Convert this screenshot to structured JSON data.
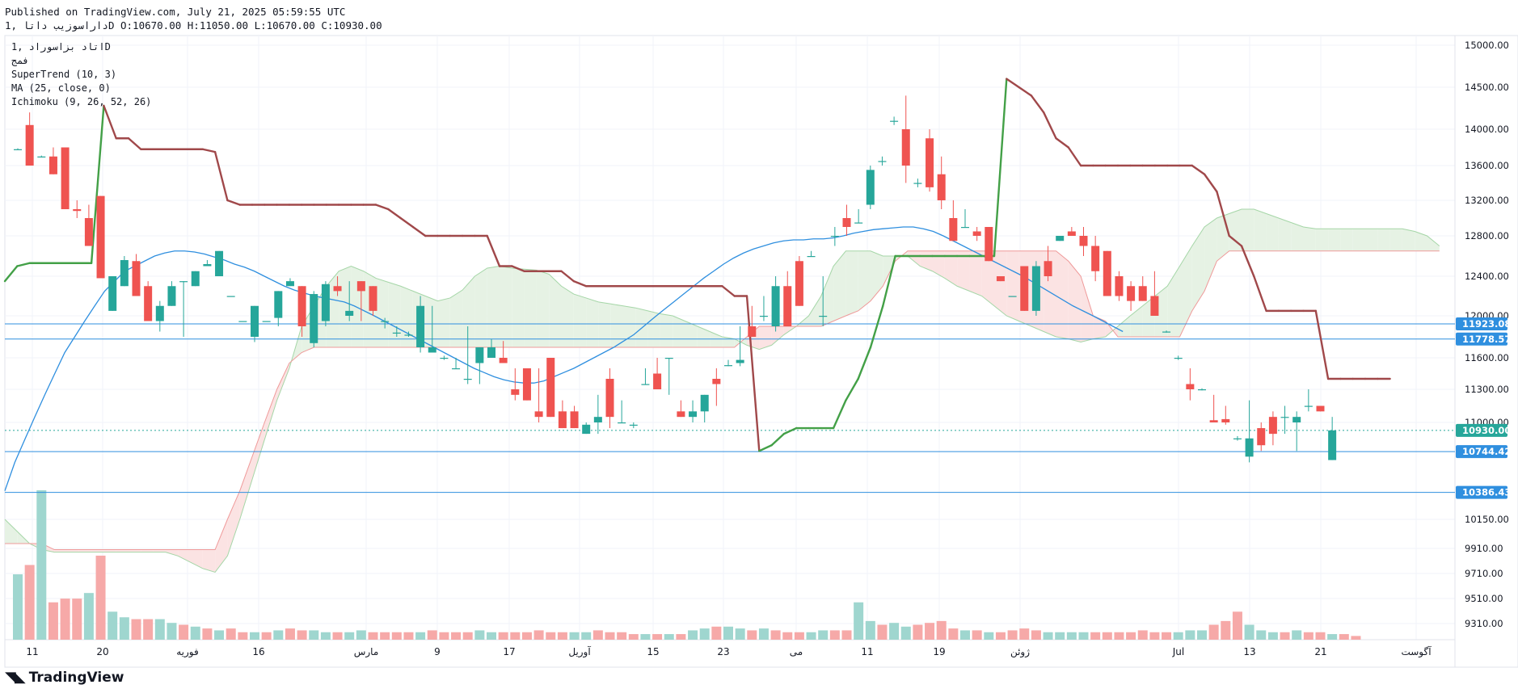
{
  "header": {
    "published": "Published on TradingView.com, July 21, 2025 05:59:55 UTC",
    "ohlc_line": "داراسوزیب داتا ,1D O:10670.00 H:11050.00 L:10670.00 C:10930.00"
  },
  "legend": {
    "symbol": "اتاد بزاسوراد ,1D",
    "exchange": "فمج",
    "indicators": [
      "SuperTrend (10, 3)",
      "MA (25, close, 0)",
      "Ichimoku (9, 26, 52, 26)"
    ]
  },
  "brand": {
    "name": "TradingView",
    "logo": "tradingview-logo-icon"
  },
  "colors": {
    "up": "#26a69a",
    "down": "#ef5350",
    "supertrend_up": "#43a047",
    "supertrend_down": "#a0484a",
    "ma": "#2f8fdf",
    "hline": "#2f8fdf",
    "cloud_bull": "#e6f2e4",
    "cloud_bear": "#fbe3e3"
  },
  "chart_data": {
    "type": "candlestick",
    "interval": "1D",
    "y_axis_ticks": [
      15000,
      14500,
      14000,
      13600,
      13200,
      12800,
      12400,
      12000,
      11600,
      11300,
      11000,
      10150,
      9910,
      9710,
      9510,
      9310
    ],
    "x_axis_ticks": [
      "11",
      "20",
      "فوریه",
      "16",
      "مارس",
      "9",
      "17",
      "آوریل",
      "15",
      "23",
      "می",
      "11",
      "19",
      "ژوئن",
      "Jul",
      "13",
      "21",
      "آگوست"
    ],
    "price_labels": [
      {
        "value": 11923.08,
        "label": "11923.08",
        "kind": "line"
      },
      {
        "value": 11778.57,
        "label": "11778.57",
        "kind": "line"
      },
      {
        "value": 10930.0,
        "label": "10930.00",
        "kind": "last"
      },
      {
        "value": 10744.42,
        "label": "10744.42",
        "kind": "line"
      },
      {
        "value": 10386.43,
        "label": "10386.43",
        "kind": "line"
      }
    ],
    "candles": [
      [
        13780,
        13790,
        13770,
        13780
      ],
      [
        14050,
        14200,
        13700,
        13600
      ],
      [
        13700,
        13710,
        13690,
        13700
      ],
      [
        13700,
        13800,
        13500,
        13500
      ],
      [
        13800,
        13800,
        13100,
        13100
      ],
      [
        13100,
        13200,
        13000,
        13080
      ],
      [
        13000,
        13150,
        12700,
        12700
      ],
      [
        13250,
        13250,
        12400,
        12380
      ],
      [
        12050,
        12400,
        12050,
        12400
      ],
      [
        12300,
        12600,
        12300,
        12560
      ],
      [
        12550,
        12620,
        12200,
        12200
      ],
      [
        12300,
        12350,
        11950,
        11950
      ],
      [
        11950,
        12150,
        11850,
        12100
      ],
      [
        12100,
        12350,
        12100,
        12300
      ],
      [
        12350,
        12350,
        11800,
        12350
      ],
      [
        12300,
        12450,
        12300,
        12450
      ],
      [
        12500,
        12560,
        12500,
        12520
      ],
      [
        12400,
        12650,
        12400,
        12650
      ],
      [
        12200,
        12200,
        12200,
        12200
      ],
      [
        11950,
        11950,
        11950,
        11950
      ],
      [
        11800,
        12100,
        11750,
        12100
      ],
      [
        11950,
        11950,
        11950,
        11950
      ],
      [
        11980,
        12250,
        11900,
        12250
      ],
      [
        12300,
        12380,
        12300,
        12350
      ],
      [
        12300,
        12300,
        11800,
        11900
      ],
      [
        11740,
        12250,
        11700,
        12220
      ],
      [
        11950,
        12350,
        11900,
        12320
      ],
      [
        12300,
        12400,
        12200,
        12250
      ],
      [
        12000,
        12350,
        11950,
        12050
      ],
      [
        12350,
        12350,
        11950,
        12250
      ],
      [
        12300,
        12300,
        12000,
        12050
      ],
      [
        11950,
        11980,
        11880,
        11950
      ],
      [
        11840,
        11900,
        11800,
        11840
      ],
      [
        11820,
        11850,
        11800,
        11820
      ],
      [
        11700,
        12200,
        11650,
        12100
      ],
      [
        11650,
        12100,
        11650,
        11700
      ],
      [
        11600,
        11620,
        11580,
        11600
      ],
      [
        11500,
        11600,
        11500,
        11500
      ],
      [
        11400,
        11900,
        11350,
        11400
      ],
      [
        11550,
        11700,
        11350,
        11700
      ],
      [
        11600,
        11780,
        11600,
        11700
      ],
      [
        11600,
        11760,
        11580,
        11550
      ],
      [
        11300,
        11500,
        11200,
        11250
      ],
      [
        11500,
        11500,
        11200,
        11200
      ],
      [
        11100,
        11500,
        11000,
        11050
      ],
      [
        11600,
        11600,
        11050,
        11050
      ],
      [
        11100,
        11200,
        10950,
        10950
      ],
      [
        11100,
        11150,
        10950,
        10950
      ],
      [
        10900,
        11000,
        10900,
        10980
      ],
      [
        11000,
        11250,
        10900,
        11050
      ],
      [
        11400,
        11500,
        10950,
        11050
      ],
      [
        11000,
        11200,
        11000,
        11000
      ],
      [
        10980,
        11000,
        10950,
        10980
      ],
      [
        11350,
        11500,
        11350,
        11350
      ],
      [
        11450,
        11600,
        11300,
        11300
      ],
      [
        11600,
        11600,
        11250,
        11600
      ],
      [
        11100,
        11200,
        11050,
        11050
      ],
      [
        11050,
        11200,
        11000,
        11100
      ],
      [
        11100,
        11250,
        11000,
        11250
      ],
      [
        11400,
        11500,
        11150,
        11350
      ],
      [
        11530,
        11580,
        11520,
        11530
      ],
      [
        11550,
        11900,
        11520,
        11580
      ],
      [
        11900,
        12100,
        11800,
        11800
      ],
      [
        12000,
        12200,
        11950,
        12000
      ],
      [
        11900,
        12400,
        11850,
        12300
      ],
      [
        12300,
        12450,
        11900,
        11900
      ],
      [
        12550,
        12600,
        12100,
        12100
      ],
      [
        12600,
        12650,
        12600,
        12600
      ],
      [
        12000,
        12400,
        11900,
        12000
      ],
      [
        12800,
        12900,
        12700,
        12800
      ],
      [
        13000,
        13150,
        12800,
        12900
      ],
      [
        12950,
        13100,
        12950,
        12950
      ],
      [
        13150,
        13600,
        13100,
        13550
      ],
      [
        13650,
        13700,
        13600,
        13650
      ],
      [
        14100,
        14150,
        14050,
        14100
      ],
      [
        14000,
        14400,
        13400,
        13600
      ],
      [
        13400,
        13450,
        13350,
        13400
      ],
      [
        13900,
        14000,
        13300,
        13350
      ],
      [
        13500,
        13700,
        13100,
        13200
      ],
      [
        13000,
        13200,
        12750,
        12750
      ],
      [
        12900,
        13100,
        12900,
        12900
      ],
      [
        12850,
        12900,
        12750,
        12800
      ],
      [
        12900,
        12900,
        12550,
        12550
      ],
      [
        12400,
        12400,
        12350,
        12350
      ],
      [
        12200,
        12200,
        12200,
        12200
      ],
      [
        12500,
        12500,
        12050,
        12050
      ],
      [
        12050,
        12550,
        12000,
        12500
      ],
      [
        12550,
        12700,
        12350,
        12400
      ],
      [
        12750,
        12800,
        12750,
        12800
      ],
      [
        12850,
        12900,
        12800,
        12800
      ],
      [
        12800,
        12900,
        12600,
        12700
      ],
      [
        12700,
        12800,
        12350,
        12450
      ],
      [
        12650,
        12650,
        12200,
        12200
      ],
      [
        12400,
        12450,
        12150,
        12200
      ],
      [
        12300,
        12350,
        12050,
        12150
      ],
      [
        12300,
        12400,
        12150,
        12150
      ],
      [
        12200,
        12450,
        12000,
        12000
      ],
      [
        11850,
        11860,
        11840,
        11850
      ],
      [
        11600,
        11620,
        11580,
        11600
      ],
      [
        11350,
        11500,
        11200,
        11300
      ],
      [
        11300,
        11310,
        11290,
        11300
      ],
      [
        11020,
        11250,
        11000,
        11000
      ],
      [
        11030,
        11150,
        10980,
        11000
      ],
      [
        10860,
        10880,
        10840,
        10860
      ],
      [
        10700,
        11200,
        10650,
        10860
      ],
      [
        10950,
        11000,
        10750,
        10800
      ],
      [
        11050,
        11100,
        10800,
        10900
      ],
      [
        11050,
        11150,
        10900,
        11050
      ],
      [
        11000,
        11100,
        10750,
        11050
      ],
      [
        11150,
        11300,
        11100,
        11150
      ],
      [
        11150,
        11150,
        11100,
        11100
      ],
      [
        10670,
        11050,
        10670,
        10930
      ]
    ],
    "supertrend": [
      12350,
      12500,
      12530,
      12530,
      12530,
      12530,
      12530,
      12530,
      14280,
      13900,
      13900,
      13780,
      13780,
      13780,
      13780,
      13780,
      13780,
      13750,
      13200,
      13150,
      13150,
      13150,
      13150,
      13150,
      13150,
      13150,
      13150,
      13150,
      13150,
      13150,
      13150,
      13100,
      13000,
      12900,
      12800,
      12800,
      12800,
      12800,
      12800,
      12800,
      12500,
      12500,
      12450,
      12450,
      12450,
      12450,
      12350,
      12300,
      12300,
      12300,
      12300,
      12300,
      12300,
      12300,
      12300,
      12300,
      12300,
      12300,
      12300,
      12200,
      12200,
      10750,
      10800,
      10900,
      10950,
      10950,
      10950,
      10950,
      11200,
      11400,
      11700,
      12100,
      12600,
      12600,
      12600,
      12600,
      12600,
      12600,
      12600,
      12600,
      12600,
      14600,
      14500,
      14400,
      14200,
      13900,
      13800,
      13600,
      13600,
      13600,
      13600,
      13600,
      13600,
      13600,
      13600,
      13600,
      13600,
      13500,
      13300,
      12800,
      12700,
      12400,
      12050,
      12050,
      12050,
      12050,
      12050,
      11400,
      11400,
      11400,
      11400,
      11400,
      11400
    ],
    "moving_average": [
      10400,
      10650,
      10850,
      11050,
      11250,
      11450,
      11650,
      11800,
      11950,
      12100,
      12250,
      12350,
      12450,
      12500,
      12550,
      12600,
      12630,
      12650,
      12650,
      12640,
      12620,
      12590,
      12560,
      12520,
      12490,
      12450,
      12400,
      12350,
      12300,
      12260,
      12230,
      12200,
      12180,
      12160,
      12140,
      12100,
      12050,
      12000,
      11950,
      11900,
      11850,
      11800,
      11750,
      11700,
      11650,
      11600,
      11550,
      11500,
      11460,
      11420,
      11390,
      11370,
      11360,
      11360,
      11380,
      11420,
      11460,
      11500,
      11550,
      11600,
      11650,
      11700,
      11760,
      11820,
      11900,
      11980,
      12060,
      12140,
      12220,
      12300,
      12380,
      12450,
      12520,
      12580,
      12630,
      12670,
      12700,
      12730,
      12750,
      12760,
      12760,
      12770,
      12770,
      12780,
      12800,
      12830,
      12850,
      12870,
      12880,
      12890,
      12900,
      12900,
      12880,
      12850,
      12800,
      12750,
      12700,
      12650,
      12600,
      12550,
      12500,
      12450,
      12400,
      12340,
      12280,
      12220,
      12160,
      12100,
      12050,
      12000,
      11950,
      11900,
      11850
    ],
    "ichimoku": {
      "cloud_start_index": 0,
      "span_a": [
        10150,
        10050,
        9950,
        9900,
        9880,
        9880,
        9880,
        9880,
        9880,
        9880,
        9880,
        9880,
        9880,
        9880,
        9850,
        9800,
        9750,
        9720,
        9850,
        10150,
        10500,
        10850,
        11200,
        11500,
        11900,
        12100,
        12300,
        12450,
        12500,
        12450,
        12380,
        12340,
        12300,
        12250,
        12200,
        12150,
        12180,
        12260,
        12400,
        12480,
        12500,
        12480,
        12470,
        12460,
        12420,
        12300,
        12220,
        12180,
        12140,
        12120,
        12100,
        12080,
        12050,
        12020,
        12000,
        11950,
        11900,
        11850,
        11800,
        11780,
        11720,
        11680,
        11720,
        11820,
        11900,
        12000,
        12200,
        12500,
        12650,
        12650,
        12650,
        12600,
        12600,
        12600,
        12500,
        12450,
        12380,
        12300,
        12250,
        12200,
        12100,
        12000,
        11950,
        11900,
        11850,
        11800,
        11780,
        11750,
        11780,
        11800,
        11900,
        12000,
        12100,
        12200,
        12300,
        12500,
        12700,
        12900,
        13000,
        13050,
        13100,
        13100,
        13050,
        13000,
        12950,
        12900,
        12880,
        12880,
        12880,
        12880,
        12880,
        12880,
        12880,
        12880,
        12850,
        12800,
        12700
      ],
      "span_b": [
        9950,
        9950,
        9950,
        9950,
        9900,
        9900,
        9900,
        9900,
        9900,
        9900,
        9900,
        9900,
        9900,
        9900,
        9900,
        9900,
        9900,
        9900,
        10150,
        10400,
        10700,
        11000,
        11300,
        11550,
        11650,
        11700,
        11700,
        11700,
        11700,
        11700,
        11700,
        11700,
        11700,
        11700,
        11700,
        11700,
        11700,
        11700,
        11700,
        11700,
        11700,
        11700,
        11700,
        11700,
        11700,
        11700,
        11700,
        11700,
        11700,
        11700,
        11700,
        11700,
        11700,
        11700,
        11700,
        11700,
        11700,
        11700,
        11700,
        11700,
        11800,
        11900,
        11900,
        11900,
        11900,
        11900,
        11900,
        11950,
        12000,
        12050,
        12150,
        12300,
        12550,
        12650,
        12650,
        12650,
        12650,
        12650,
        12650,
        12650,
        12650,
        12650,
        12650,
        12650,
        12650,
        12650,
        12550,
        12400,
        12000,
        11950,
        11800,
        11800,
        11800,
        11800,
        11800,
        11800,
        12050,
        12250,
        12550,
        12650,
        12650,
        12650,
        12650,
        12650,
        12650,
        12650,
        12650,
        12650,
        12650,
        12650,
        12650,
        12650,
        12650,
        12650,
        12650,
        12650,
        12650
      ]
    },
    "volume": [
      35,
      40,
      80,
      20,
      22,
      22,
      25,
      45,
      15,
      12,
      11,
      11,
      11,
      9,
      8,
      7,
      6,
      5,
      6,
      4,
      4,
      4,
      5,
      6,
      5,
      5,
      4,
      4,
      4,
      5,
      4,
      4,
      4,
      4,
      4,
      5,
      4,
      4,
      4,
      5,
      4,
      4,
      4,
      4,
      5,
      4,
      4,
      4,
      4,
      5,
      4,
      4,
      3,
      3,
      3,
      3,
      3,
      5,
      6,
      7,
      7,
      6,
      5,
      6,
      5,
      4,
      4,
      4,
      5,
      5,
      5,
      20,
      10,
      8,
      9,
      7,
      8,
      9,
      10,
      6,
      5,
      5,
      4,
      4,
      5,
      6,
      5,
      4,
      4,
      4,
      4,
      4,
      4,
      4,
      4,
      5,
      4,
      4,
      4,
      5,
      5,
      8,
      10,
      15,
      8,
      5,
      4,
      4,
      5,
      4,
      4,
      3,
      3,
      2
    ],
    "volume_up": [
      true,
      false,
      true,
      false,
      false,
      false,
      true,
      false,
      true,
      true,
      false,
      false,
      true,
      true,
      false,
      true,
      false,
      true,
      false,
      false,
      true,
      false,
      true,
      false,
      false,
      true,
      true,
      false,
      true,
      true,
      false,
      false,
      false,
      false,
      true,
      false,
      false,
      false,
      false,
      true,
      true,
      false,
      false,
      false,
      false,
      false,
      false,
      true,
      true,
      false,
      false,
      false,
      false,
      true,
      false,
      true,
      false,
      true,
      true,
      false,
      true,
      true,
      false,
      true,
      false,
      false,
      false,
      true,
      true,
      false,
      false,
      true,
      true,
      false,
      true,
      true,
      false,
      false,
      false,
      false,
      true,
      false,
      true,
      false,
      false,
      false,
      false,
      true,
      true,
      true,
      true,
      false,
      false,
      false,
      false,
      false,
      false,
      false,
      true,
      true,
      true,
      false,
      false,
      false,
      true,
      true,
      true,
      false,
      true,
      false,
      false,
      true
    ]
  }
}
